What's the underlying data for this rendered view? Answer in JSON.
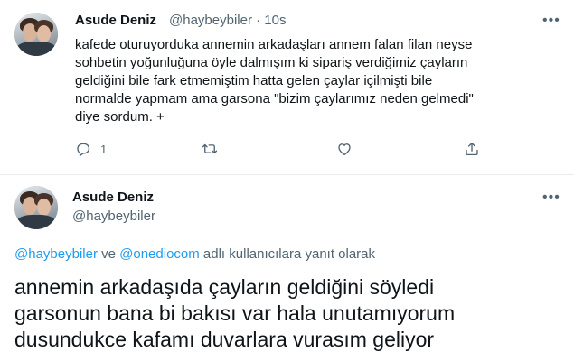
{
  "tweet": {
    "author": "Asude Deniz",
    "handle": "@haybeybiler",
    "separator": "·",
    "time": "10s",
    "more_icon": "more-horizontal-icon",
    "text": "kafede oturuyorduka annemin arkadaşları annem falan filan neyse\nsohbetin yoğunluğuna öyle dalmışım ki sipariş verdiğimiz çayların\ngeldiğini bile fark etmemiştim hatta gelen çaylar içilmişti bile\nnormalde yapmam ama garsona \"bizim çaylarımız neden gelmedi\"\ndiye sordum. +",
    "actions": {
      "reply_count": "1",
      "reply_icon": "reply-icon",
      "retweet_icon": "retweet-icon",
      "like_icon": "heart-icon",
      "share_icon": "share-icon"
    }
  },
  "reply": {
    "author": "Asude Deniz",
    "handle": "@haybeybiler",
    "replying_mention_1": "@haybeybiler",
    "replying_and": " ve ",
    "replying_mention_2": "@onediocom",
    "replying_suffix": " adlı kullanıcılara yanıt olarak",
    "text": "annemin arkadaşıda çayların geldiğini söyledi\ngarsonun bana bi bakısı var hala unutamıyorum\ndusundukce kafamı duvarlara vurasım geliyor"
  },
  "colors": {
    "text": "#0f1419",
    "secondary": "#536471",
    "link": "#1d9bf0",
    "divider": "#e6ecf0"
  }
}
